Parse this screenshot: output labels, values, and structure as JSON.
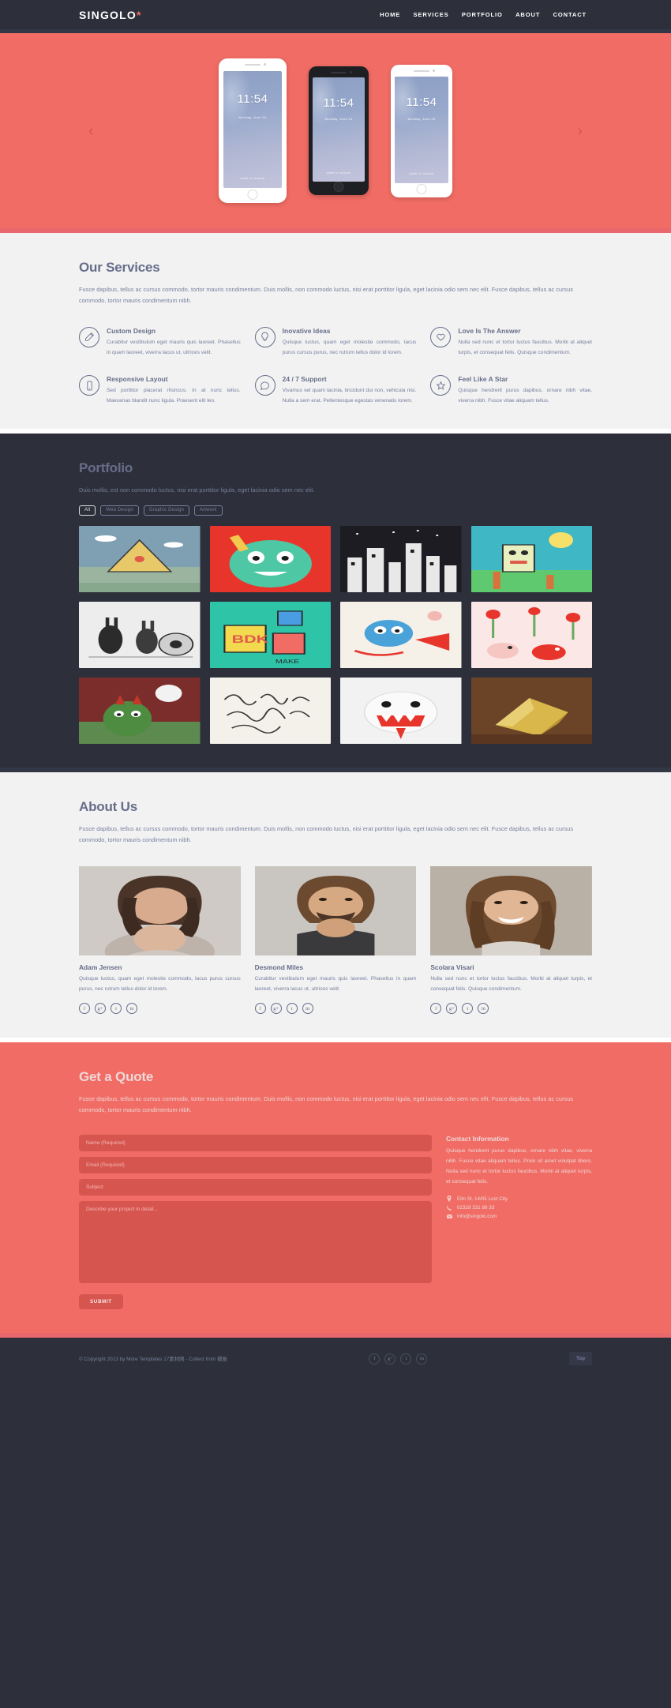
{
  "colors": {
    "dark": "#2d303a",
    "accent": "#f06c64",
    "light": "#f2f2f2",
    "muted_text": "#767e9e",
    "heading": "#666d89"
  },
  "header": {
    "logo": "SINGOLO",
    "logo_dot": "*",
    "nav": [
      {
        "label": "HOME"
      },
      {
        "label": "SERVICES"
      },
      {
        "label": "PORTFOLIO"
      },
      {
        "label": "ABOUT"
      },
      {
        "label": "CONTACT"
      }
    ]
  },
  "slider": {
    "prev_icon": "chevron-left",
    "next_icon": "chevron-right",
    "phones": [
      {
        "time": "11:54",
        "date": "Monday, June 24",
        "slide_label": "slide to unlock",
        "style": "vertical-white"
      },
      {
        "time": "11:54",
        "date": "Monday, June 24",
        "slide_label": "slide to unlock",
        "style": "vertical-black"
      },
      {
        "time": "11:54",
        "date": "Monday, June 24",
        "slide_label": "slide to unlock",
        "style": "vertical-white-2"
      }
    ]
  },
  "services": {
    "title": "Our Services",
    "subtitle": "Fusce dapibus, tellus ac cursus commodo, tortor mauris condimentum. Duis mollis, non commodo luctus, nisi erat porttitor ligula, eget lacinia odio sem nec elit. Fusce dapibus, tellus ac cursus commodo, tortor mauris condimentum nibh.",
    "items": [
      {
        "icon": "pencil-icon",
        "title": "Custom Design",
        "text": "Curabitur vestibulum eget mauris quis laoreet. Phasellus in quam laoreet, viverra lacus ut, ultrices velit."
      },
      {
        "icon": "lightbulb-icon",
        "title": "Inovative Ideas",
        "text": "Quisque luctus, quam eget molestie commodo, lacus purus cursus purus, nec rutrum tellus dolor id lorem."
      },
      {
        "icon": "heart-icon",
        "title": "Love Is The Answer",
        "text": "Nulla sed nunc et tortor luctus faucibus. Morbi at aliquet turpis, et consequat felis. Quisque condimentum."
      },
      {
        "icon": "mobile-icon",
        "title": "Responsive Layout",
        "text": "Sed porttitor placerat rhoncus. In at nunc tellus. Maecenas blandit nunc ligula. Praesent elit leo."
      },
      {
        "icon": "chat-icon",
        "title": "24 / 7 Support",
        "text": "Vivamus vel quam lacinia, tincidunt dui non, vehicula nisi. Nulla a sem erat. Pellentesque egestas venenatis lorem."
      },
      {
        "icon": "star-icon",
        "title": "Feel Like A Star",
        "text": "Quisque hendrerit purus dapibus, ornare nibh vitae, viverra nibh. Fusce vitae aliquam tellus."
      }
    ]
  },
  "portfolio": {
    "title": "Portfolio",
    "subtitle": "Duis mollis, est non commodo luctus, nisi erat porttitor ligula, eget lacinia odio sem nec elit.",
    "filters": [
      {
        "label": "All",
        "active": true
      },
      {
        "label": "Web Design",
        "active": false
      },
      {
        "label": "Graphic Design",
        "active": false
      },
      {
        "label": "Artwork",
        "active": false
      }
    ],
    "items": [
      {
        "name": "pyramid-illustration"
      },
      {
        "name": "green-monster-illustration"
      },
      {
        "name": "city-sketch-illustration"
      },
      {
        "name": "robot-poster-illustration"
      },
      {
        "name": "rabbit-characters-illustration"
      },
      {
        "name": "bdk-blocks-illustration"
      },
      {
        "name": "blue-creature-illustration"
      },
      {
        "name": "birds-pattern-illustration"
      },
      {
        "name": "red-monster-illustration"
      },
      {
        "name": "handwriting-sketch-illustration"
      },
      {
        "name": "white-monster-illustration"
      },
      {
        "name": "gold-wrapper-illustration"
      }
    ]
  },
  "about": {
    "title": "About Us",
    "subtitle": "Fusce dapibus, tellus ac cursus commodo, tortor mauris condimentum. Duis mollis, non commodo luctus, nisi erat porttitor ligula, eget lacinia odio sem nec elit. Fusce dapibus, tellus ac cursus commodo, tortor mauris condimentum nibh.",
    "members": [
      {
        "name": "Adam Jensen",
        "bio": "Quisque luctus, quam eget molestie commodo, lacus purus cursus purus, nec rutrum tellus dolor id lorem.",
        "socials": [
          "f",
          "g+",
          "t",
          "in"
        ]
      },
      {
        "name": "Desmond Miles",
        "bio": "Curabitur vestibulum eget mauris quis laoreet. Phasellus in quam laoreet, viverra lacus ut, ultrices velit.",
        "socials": [
          "f",
          "g+",
          "t",
          "in"
        ]
      },
      {
        "name": "Scolara Visari",
        "bio": "Nulla sed nunc et tortor luctus faucibus. Morbi at aliquet turpis, et consequat felis. Quisque condimentum.",
        "socials": [
          "f",
          "g+",
          "t",
          "in"
        ]
      }
    ]
  },
  "quote": {
    "title": "Get a Quote",
    "subtitle": "Fusce dapibus, tellus ac cursus commodo, tortor mauris condimentum. Duis mollis, non commodo luctus, nisi erat porttitor ligula, eget lacinia odio sem nec elit. Fusce dapibus, tellus ac cursus commodo, tortor mauris condimentum nibh.",
    "form": {
      "name_placeholder": "Name (Required)",
      "name_value": "",
      "email_placeholder": "Email (Required)",
      "email_value": "",
      "subject_placeholder": "Subject",
      "subject_value": "",
      "message_placeholder": "Describe your project in detail...",
      "message_value": "",
      "submit_label": "SUBMIT"
    },
    "contact": {
      "title": "Contact Information",
      "text": "Quisque hendrerit purus dapibus, ornare nibh vitae, viverra nibh. Fusce vitae aliquam tellus. Proin sit amet volutpat libero. Nulla sed nunc et tortor luctus faucibus. Morbi at aliquet turpis, et consequat felis.",
      "address": "Elm St. 14/05 Lost City",
      "address_icon": "location-pin-icon",
      "phone": "02328 331 86 33",
      "phone_icon": "phone-icon",
      "email": "info@singolo.com",
      "email_icon": "envelope-icon"
    }
  },
  "footer": {
    "copyright": "© Copyright 2013 by More Templates 17素材网 - Collect from 模板",
    "socials": [
      "f",
      "g+",
      "t",
      "in"
    ],
    "top_label": "Top"
  }
}
